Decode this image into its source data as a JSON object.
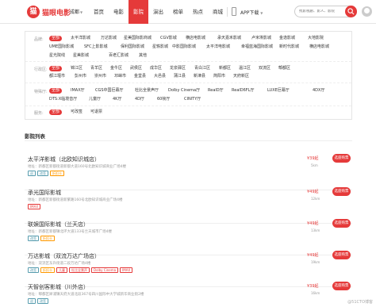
{
  "header": {
    "logo_mark": "猫",
    "logo_text": "猫眼电影",
    "city": "成都",
    "nav": [
      "首页",
      "电影",
      "影院",
      "演出",
      "榜单",
      "热点",
      "商城"
    ],
    "active_nav": 2,
    "app_download": "APP下载",
    "search_placeholder": "找影视剧、影人、影院"
  },
  "filters": {
    "brand": {
      "label": "品牌:",
      "tags": [
        "全部",
        "太平洋影城",
        "万达影城",
        "星美国际影商城",
        "CGV影城",
        "横店电影城",
        "承天嘉禾影城",
        "卢米埃影城",
        "金逸影城",
        "大地影院",
        "UME国际影城",
        "SFC上影影城",
        "保利国际影城",
        "星轶影城",
        "中影国际影城",
        "太平洋电影城",
        "幸福蓝海国际影城",
        "新时代影城",
        "横店电影城",
        "星光院线",
        "星美影城",
        "百老汇影城",
        "其他"
      ]
    },
    "district": {
      "label": "行政区:",
      "tags": [
        "全部",
        "锦江区",
        "青羊区",
        "金牛区",
        "武侯区",
        "成华区",
        "龙泉驿区",
        "青白江区",
        "新都区",
        "温江区",
        "双流区",
        "郫都区",
        "都江堰市",
        "彭州市",
        "崇州市",
        "邛崃市",
        "金堂县",
        "大邑县",
        "蒲江县",
        "新津县",
        "简阳市",
        "天府新区"
      ]
    },
    "hall": {
      "label": "特殊厅:",
      "tags": [
        "全部",
        "IMAX厅",
        "CGS中国巨幕厅",
        "杜比全景声厅",
        "Dolby Cinema厅",
        "RealD厅",
        "RealD6FL厅",
        "LUXE巨幕厅",
        "4DX厅",
        "DTS:X临境音厅",
        "儿童厅",
        "4K厅",
        "4D厅",
        "60帧厅",
        "CINITY厅"
      ]
    },
    "service": {
      "label": "服务:",
      "tags": [
        "全部",
        "可改签",
        "可退票"
      ]
    }
  },
  "list": {
    "title": "影院列表",
    "cinemas": [
      {
        "name": "太平洋影城（北欧知识城店）",
        "address": "地址：新都区新都街道新都大道160号北欧知识城商业广场4楼",
        "tags": [
          "退",
          "改签",
          "折扣卡"
        ],
        "price": "¥39起",
        "distance": "5km",
        "button": "选座购票"
      },
      {
        "name": "承光国际影城",
        "address": "地址：新都区新都街道新繁路160号北欧知识城商业广场4楼",
        "tags": [
          "IMAX"
        ],
        "price": "¥49起",
        "distance": "12km",
        "button": "选座购票"
      },
      {
        "name": "联娱国际影城（兰天店）",
        "address": "地址：新都区新都镇北环大道133号兰天城市广场4楼",
        "tags": [
          "改签",
          "折扣卡"
        ],
        "price": "¥49起",
        "distance": "13km",
        "button": "选座购票"
      },
      {
        "name": "万达影城（双流万达广场店）",
        "address": "地址：双流区东升街道二段万达广场4楼",
        "tags": [
          "改签",
          "折扣卡",
          "儿童",
          "杜比全景声",
          "Dolby Cinema",
          "IMAX"
        ],
        "price": "¥49起",
        "distance": "19km",
        "button": "选座购票"
      },
      {
        "name": "天智创客影城（川外店）",
        "address": "地址：郫都区犀浦镇天府大道北段367号四川国际中大学城新华商业街2楼",
        "tags": [
          "退",
          "改签"
        ],
        "price": "¥39起",
        "distance": "16km",
        "button": "选座购票"
      }
    ]
  },
  "watermark": "@51CTO博客"
}
